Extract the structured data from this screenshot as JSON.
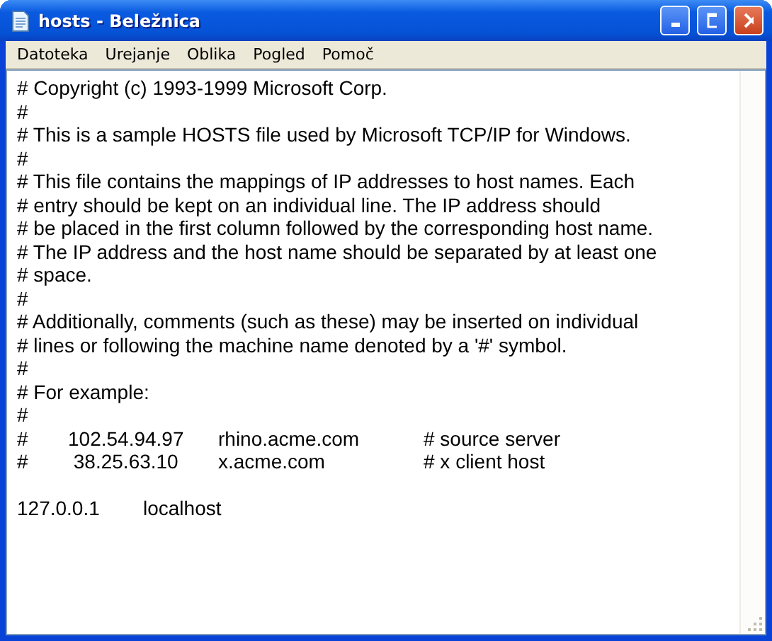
{
  "window": {
    "title": "hosts - Beležnica"
  },
  "menu": [
    "Datoteka",
    "Urejanje",
    "Oblika",
    "Pogled",
    "Pomoč"
  ],
  "lines": [
    {
      "kind": "text",
      "text": "# Copyright (c) 1993-1999 Microsoft Corp."
    },
    {
      "kind": "text",
      "text": "#"
    },
    {
      "kind": "text",
      "text": "# This is a sample HOSTS file used by Microsoft TCP/IP for Windows."
    },
    {
      "kind": "text",
      "text": "#"
    },
    {
      "kind": "text",
      "text": "# This file contains the mappings of IP addresses to host names. Each"
    },
    {
      "kind": "text",
      "text": "# entry should be kept on an individual line. The IP address should"
    },
    {
      "kind": "text",
      "text": "# be placed in the first column followed by the corresponding host name."
    },
    {
      "kind": "text",
      "text": "# The IP address and the host name should be separated by at least one"
    },
    {
      "kind": "text",
      "text": "# space."
    },
    {
      "kind": "text",
      "text": "#"
    },
    {
      "kind": "text",
      "text": "# Additionally, comments (such as these) may be inserted on individual"
    },
    {
      "kind": "text",
      "text": "# lines or following the machine name denoted by a '#' symbol."
    },
    {
      "kind": "text",
      "text": "#"
    },
    {
      "kind": "text",
      "text": "# For example:"
    },
    {
      "kind": "text",
      "text": "#"
    },
    {
      "kind": "columns",
      "cells": [
        "#",
        "102.54.94.97",
        "rhino.acme.com",
        "# source server"
      ]
    },
    {
      "kind": "columns",
      "cells": [
        "#",
        " 38.25.63.10",
        "x.acme.com",
        "# x client host"
      ]
    },
    {
      "kind": "blank"
    },
    {
      "kind": "columns",
      "cells": [
        "127.0.0.1",
        "localhost"
      ]
    }
  ]
}
